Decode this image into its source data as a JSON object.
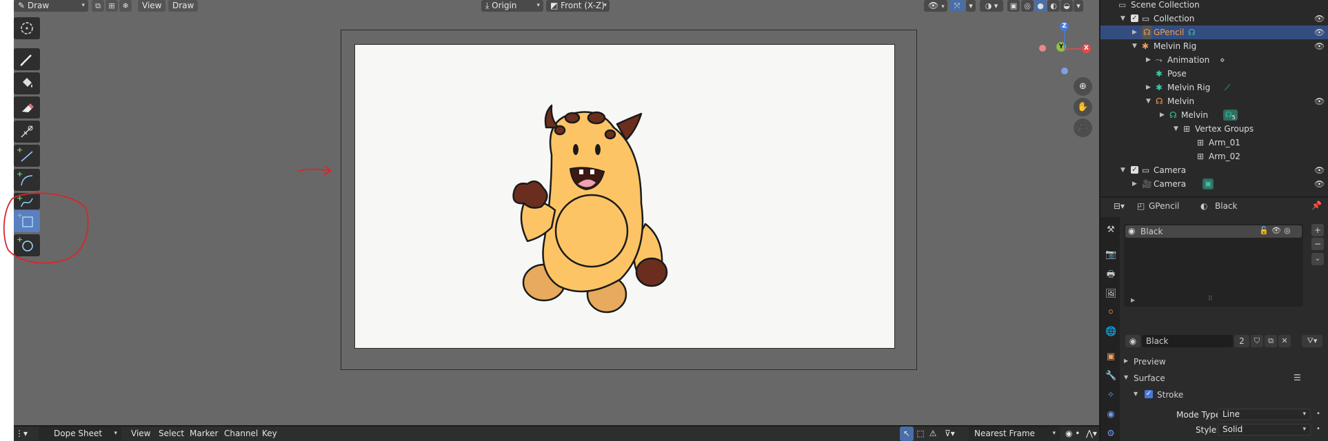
{
  "header": {
    "mode_label": "Draw",
    "menu_view": "View",
    "menu_draw": "Draw",
    "origin_label": "Origin",
    "view_label": "Front (X-Z)"
  },
  "gizmo": {
    "z": "Z",
    "y": "Y",
    "x": "X"
  },
  "toolbar": {
    "tools": [
      "cursor-icon",
      "draw-pencil-icon",
      "fill-bucket-icon",
      "eraser-icon",
      "cutter-icon",
      "line-tool-icon",
      "arc-tool-icon",
      "curve-tool-icon",
      "box-tool-icon",
      "circle-tool-icon"
    ],
    "active_tool": "box-tool-icon"
  },
  "outliner": {
    "rows": [
      {
        "label": "Scene Collection"
      },
      {
        "label": "Collection"
      },
      {
        "label": "GPencil"
      },
      {
        "label": "Melvin Rig"
      },
      {
        "label": "Animation"
      },
      {
        "label": "Pose"
      },
      {
        "label": "Melvin Rig"
      },
      {
        "label": "Melvin"
      },
      {
        "label": "Melvin"
      },
      {
        "label": "Vertex Groups"
      },
      {
        "label": "Arm_01"
      },
      {
        "label": "Arm_02"
      },
      {
        "label": "Camera"
      },
      {
        "label": "Camera"
      }
    ],
    "modifier_count": "5"
  },
  "properties": {
    "breadcrumb_object": "GPencil",
    "breadcrumb_material": "Black",
    "slot_name": "Black",
    "material_name": "Black",
    "user_count": "2",
    "panel_preview": "Preview",
    "panel_surface": "Surface",
    "panel_stroke": "Stroke",
    "mode_type_label": "Mode Type",
    "mode_type_value": "Line",
    "style_label": "Style",
    "style_value": "Solid"
  },
  "timeline": {
    "editor_label": "Dope Sheet",
    "menu": [
      "View",
      "Select",
      "Marker",
      "Channel",
      "Key"
    ],
    "snap_label": "Nearest Frame"
  },
  "colors": {
    "accent_selected": "#334d80",
    "active_tool": "#5b7fbf",
    "annotation_red": "#d8262a",
    "character_body": "#fdc465",
    "character_spots": "#6b2e1e"
  }
}
